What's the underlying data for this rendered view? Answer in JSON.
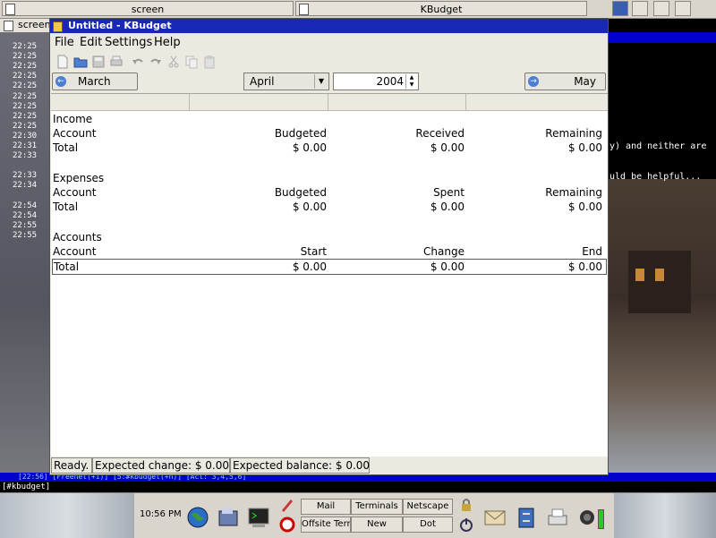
{
  "top_taskbar": {
    "tasks": [
      {
        "label": "screen"
      },
      {
        "label": "KBudget"
      }
    ]
  },
  "terminal": {
    "tab_label": "screen",
    "times": [
      "22:25",
      "22:25",
      "22:25",
      "22:25",
      "22:25",
      "22:25",
      "22:25",
      "22:25",
      "22:25",
      "22:30",
      "22:31",
      "22:33",
      "",
      "22:33",
      "22:34",
      "",
      "22:54",
      "22:54",
      "22:55",
      "22:55"
    ],
    "right_text_1": "y) and neither are",
    "right_text_2": "uld be helpful...",
    "status_line": "[22:56] [Freenet(+i)] [5:#kbudget(+n)] [Act: 3,4,5,6]",
    "prompt": "[#kbudget]"
  },
  "window": {
    "title": "Untitled - KBudget",
    "menu": {
      "file": "File",
      "edit": "Edit",
      "settings": "Settings",
      "help": "Help"
    },
    "nav": {
      "prev_month": "March",
      "month": "April",
      "year": "2004",
      "next_month": "May"
    },
    "income": {
      "heading": "Income",
      "columns": [
        "Account",
        "Budgeted",
        "Received",
        "Remaining"
      ],
      "total": [
        "Total",
        "$ 0.00",
        "$ 0.00",
        "$ 0.00"
      ]
    },
    "expenses": {
      "heading": "Expenses",
      "columns": [
        "Account",
        "Budgeted",
        "Spent",
        "Remaining"
      ],
      "total": [
        "Total",
        "$ 0.00",
        "$ 0.00",
        "$ 0.00"
      ]
    },
    "accounts": {
      "heading": "Accounts",
      "columns": [
        "Account",
        "Start",
        "Change",
        "End"
      ],
      "total": [
        "Total",
        "$ 0.00",
        "$ 0.00",
        "$ 0.00"
      ]
    },
    "status": {
      "state": "Ready.",
      "expected_change": "Expected change: $ 0.00",
      "expected_balance": "Expected balance: $ 0.00"
    }
  },
  "panel": {
    "clock": "10:56 PM",
    "buttons": {
      "mail": "Mail",
      "terminals": "Terminals",
      "netscape": "Netscape",
      "offsite": "Offsite Term",
      "new": "New",
      "dot": "Dot"
    }
  },
  "colors": {
    "titlebar": "#1a28b8",
    "terminal_status": "#0000cc",
    "window_bg": "#ece9e1"
  }
}
